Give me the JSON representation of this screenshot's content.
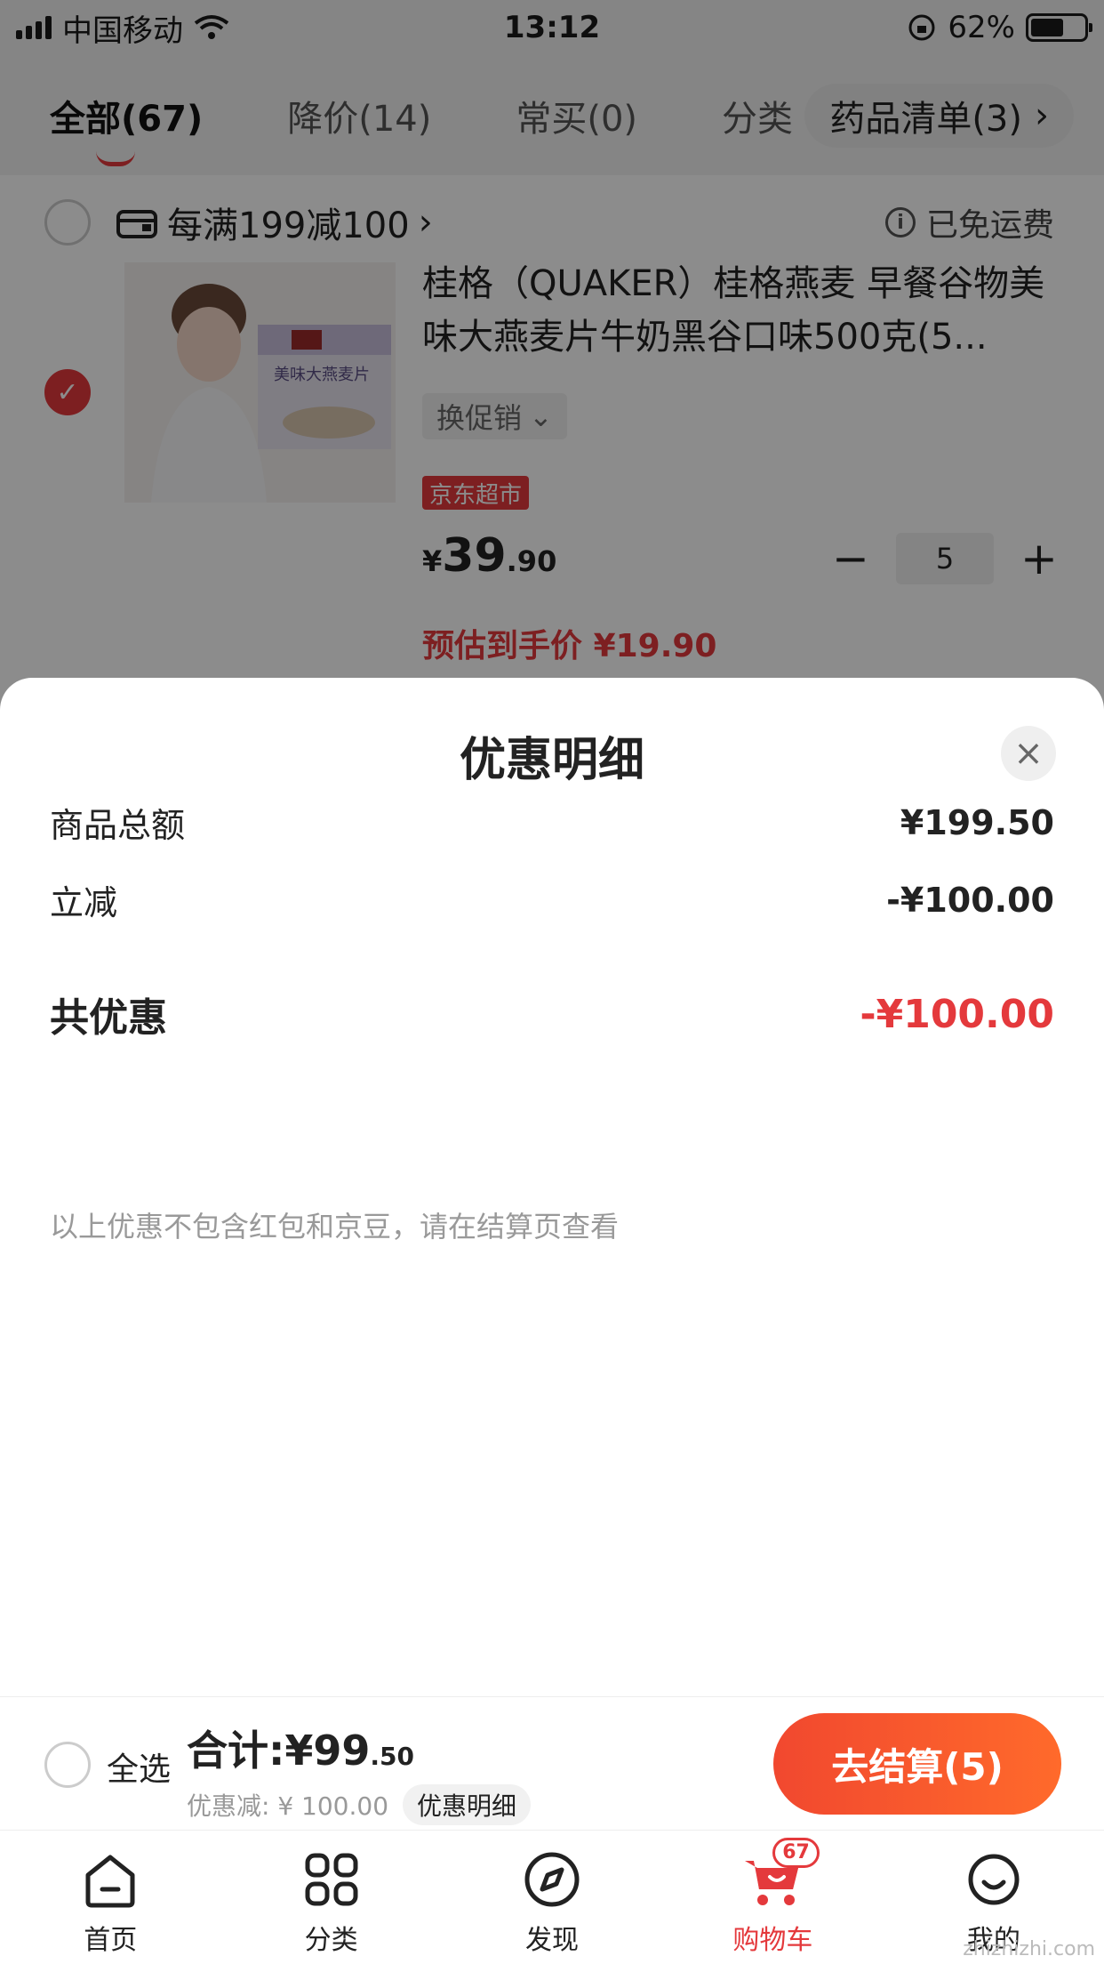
{
  "status_bar": {
    "carrier": "中国移动",
    "time": "13:12",
    "battery_pct": "62%",
    "battery_level": 0.62
  },
  "tabs": [
    {
      "label": "全部(67)"
    },
    {
      "label": "降价(14)"
    },
    {
      "label": "常买(0)"
    },
    {
      "label": "分类"
    }
  ],
  "drug_list": {
    "label": "药品清单(3)",
    "chevron": "›"
  },
  "shop": {
    "promo": "每满199减100",
    "chevron": "›",
    "shipping": "已免运费",
    "info_glyph": "i"
  },
  "item": {
    "title": "桂格（QUAKER）桂格燕麦 早餐谷物美味大燕麦片牛奶黑谷口味500克(5...",
    "thumb_box_text": "美味大燕麦片",
    "swap_promo": "换促销",
    "tag": "京东超市",
    "price_symbol": "¥",
    "price_int": "39",
    "price_dec": ".90",
    "quantity": "5",
    "minus": "−",
    "plus": "+",
    "estimate_label": "预估到手价",
    "estimate_price": "¥19.90"
  },
  "sheet": {
    "title": "优惠明细",
    "close": "×",
    "rows": [
      {
        "label": "商品总额",
        "amount": "¥199.50"
      },
      {
        "label": "立减",
        "amount": "-¥100.00"
      }
    ],
    "total": {
      "label": "共优惠",
      "amount": "-¥100.00"
    },
    "note": "以上优惠不包含红包和京豆，请在结算页查看"
  },
  "checkout": {
    "select_all": "全选",
    "sum_prefix": "合计:¥99",
    "sum_cents": ".50",
    "discount": "优惠减: ¥ 100.00",
    "detail_chip": "优惠明细",
    "pay_button": "去结算(5)"
  },
  "tabbar": [
    {
      "label": "首页",
      "icon": "home-icon"
    },
    {
      "label": "分类",
      "icon": "category-icon"
    },
    {
      "label": "发现",
      "icon": "compass-icon"
    },
    {
      "label": "购物车",
      "icon": "cart-icon",
      "badge": "67"
    },
    {
      "label": "我的",
      "icon": "profile-icon"
    }
  ],
  "watermark": "zhizhizhi.com",
  "colors": {
    "accent": "#e4393c",
    "button_gradient_start": "#f1482f",
    "button_gradient_end": "#ff6a2b"
  }
}
